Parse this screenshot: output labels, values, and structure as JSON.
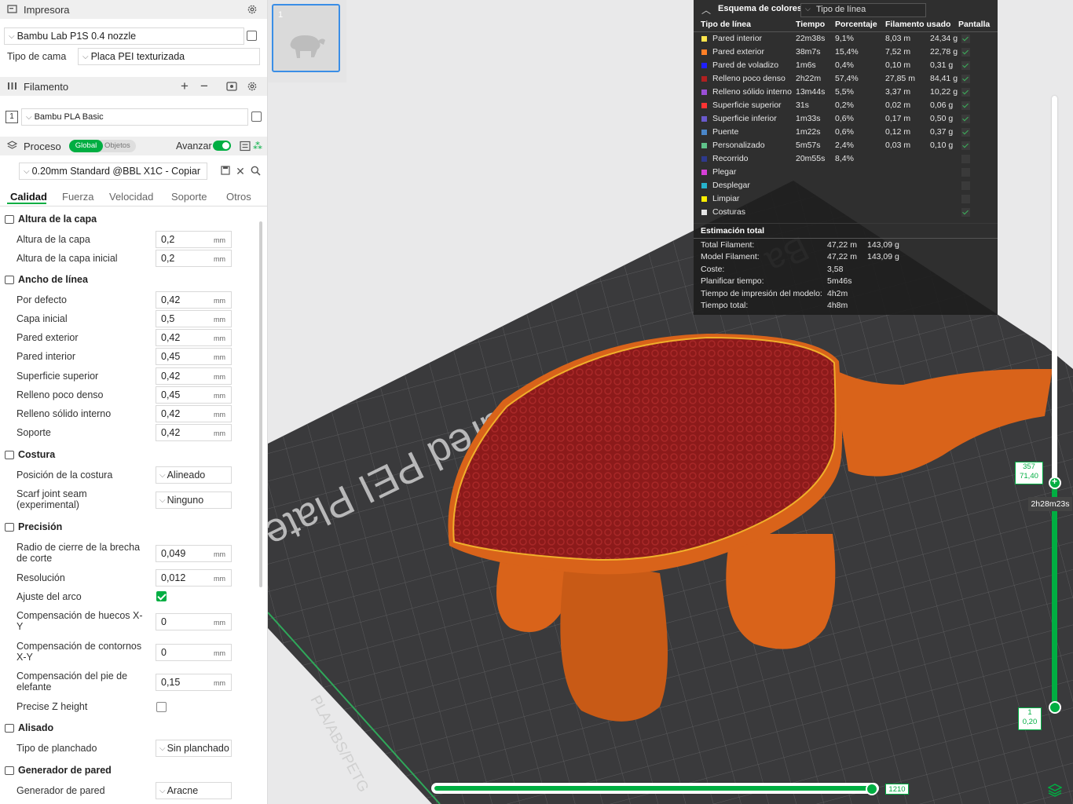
{
  "printer": {
    "section_label": "Impresora",
    "model": "Bambu Lab P1S 0.4 nozzle",
    "bed_label": "Tipo de cama",
    "bed_value": "Placa PEI texturizada"
  },
  "filament": {
    "section_label": "Filamento",
    "slot": "1",
    "name": "Bambu PLA Basic"
  },
  "process": {
    "section_label": "Proceso",
    "toggle_global": "Global",
    "toggle_objects": "Objetos",
    "advanced_label": "Avanzar",
    "preset": "0.20mm Standard @BBL X1C - Copiar"
  },
  "tabs": [
    "Calidad",
    "Fuerza",
    "Velocidad",
    "Soporte",
    "Otros"
  ],
  "groups": {
    "layer_height": "Altura de la capa",
    "line_width": "Ancho de línea",
    "seam": "Costura",
    "precision": "Precisión",
    "ironing": "Alisado",
    "wall_generator": "Generador de pared"
  },
  "settings": {
    "layer_height": {
      "label": "Altura de la capa",
      "value": "0,2",
      "unit": "mm"
    },
    "initial_layer_height": {
      "label": "Altura de la capa inicial",
      "value": "0,2",
      "unit": "mm"
    },
    "lw_default": {
      "label": "Por defecto",
      "value": "0,42",
      "unit": "mm"
    },
    "lw_initial": {
      "label": "Capa inicial",
      "value": "0,5",
      "unit": "mm"
    },
    "lw_outer": {
      "label": "Pared exterior",
      "value": "0,42",
      "unit": "mm"
    },
    "lw_inner": {
      "label": "Pared interior",
      "value": "0,45",
      "unit": "mm"
    },
    "lw_top": {
      "label": "Superficie superior",
      "value": "0,42",
      "unit": "mm"
    },
    "lw_sparse": {
      "label": "Relleno poco denso",
      "value": "0,45",
      "unit": "mm"
    },
    "lw_solid": {
      "label": "Relleno sólido interno",
      "value": "0,42",
      "unit": "mm"
    },
    "lw_support": {
      "label": "Soporte",
      "value": "0,42",
      "unit": "mm"
    },
    "seam_position": {
      "label": "Posición de la costura",
      "value": "Alineado"
    },
    "scarf_seam": {
      "label": "Scarf joint seam (experimental)",
      "value": "Ninguno"
    },
    "slice_gap": {
      "label": "Radio de cierre de la brecha de corte",
      "value": "0,049",
      "unit": "mm"
    },
    "resolution": {
      "label": "Resolución",
      "value": "0,012",
      "unit": "mm"
    },
    "arc_fitting": {
      "label": "Ajuste del arco",
      "checked": true
    },
    "xy_hole": {
      "label": "Compensación de huecos X-Y",
      "value": "0",
      "unit": "mm"
    },
    "xy_contour": {
      "label": "Compensación de contornos X-Y",
      "value": "0",
      "unit": "mm"
    },
    "elephant_foot": {
      "label": "Compensación del pie de elefante",
      "value": "0,15",
      "unit": "mm"
    },
    "precise_z": {
      "label": "Precise Z height",
      "checked": false
    },
    "ironing_type": {
      "label": "Tipo de planchado",
      "value": "Sin planchado"
    },
    "wall_gen": {
      "label": "Generador de pared",
      "value": "Aracne"
    }
  },
  "plate": {
    "thumb_number": "1",
    "bed_text": "Textured PEI Plate",
    "bed_text_partial": "Ba",
    "bed_badge": "PLA/ABS/PETG"
  },
  "legend": {
    "title": "Esquema de colores",
    "view_type": "Tipo de línea",
    "columns": [
      "Tipo de línea",
      "Tiempo",
      "Porcentaje",
      "Filamento usado",
      "Pantalla"
    ],
    "rows": [
      {
        "name": "Pared interior",
        "color": "#ffe54c",
        "time": "22m38s",
        "pct": "9,1%",
        "len": "8,03 m",
        "weight": "24,34 g",
        "shown": true
      },
      {
        "name": "Pared exterior",
        "color": "#ff7f26",
        "time": "38m7s",
        "pct": "15,4%",
        "len": "7,52 m",
        "weight": "22,78 g",
        "shown": true
      },
      {
        "name": "Pared de voladizo",
        "color": "#1f1fff",
        "time": "1m6s",
        "pct": "0,4%",
        "len": "0,10 m",
        "weight": "0,31 g",
        "shown": true
      },
      {
        "name": "Relleno poco denso",
        "color": "#b02020",
        "time": "2h22m",
        "pct": "57,4%",
        "len": "27,85 m",
        "weight": "84,41 g",
        "shown": true
      },
      {
        "name": "Relleno sólido interno",
        "color": "#9a4fd6",
        "time": "13m44s",
        "pct": "5,5%",
        "len": "3,37 m",
        "weight": "10,22 g",
        "shown": true
      },
      {
        "name": "Superficie superior",
        "color": "#ff3333",
        "time": "31s",
        "pct": "0,2%",
        "len": "0,02 m",
        "weight": "0,06 g",
        "shown": true
      },
      {
        "name": "Superficie inferior",
        "color": "#6a5acd",
        "time": "1m33s",
        "pct": "0,6%",
        "len": "0,17 m",
        "weight": "0,50 g",
        "shown": true
      },
      {
        "name": "Puente",
        "color": "#4a86c8",
        "time": "1m22s",
        "pct": "0,6%",
        "len": "0,12 m",
        "weight": "0,37 g",
        "shown": true
      },
      {
        "name": "Personalizado",
        "color": "#5fc38a",
        "time": "5m57s",
        "pct": "2,4%",
        "len": "0,03 m",
        "weight": "0,10 g",
        "shown": true
      },
      {
        "name": "Recorrido",
        "color": "#2e3a8c",
        "time": "20m55s",
        "pct": "8,4%",
        "len": "",
        "weight": "",
        "shown": false
      },
      {
        "name": "Plegar",
        "color": "#d63fd6",
        "time": "",
        "pct": "",
        "len": "",
        "weight": "",
        "shown": false
      },
      {
        "name": "Desplegar",
        "color": "#26b3cc",
        "time": "",
        "pct": "",
        "len": "",
        "weight": "",
        "shown": false
      },
      {
        "name": "Limpiar",
        "color": "#ffee00",
        "time": "",
        "pct": "",
        "len": "",
        "weight": "",
        "shown": false
      },
      {
        "name": "Costuras",
        "color": "#e6e6e6",
        "time": "",
        "pct": "",
        "len": "",
        "weight": "",
        "shown": true
      }
    ],
    "estimate_title": "Estimación total",
    "estimates": [
      {
        "label": "Total Filament:",
        "v1": "47,22 m",
        "v2": "143,09 g"
      },
      {
        "label": "Model Filament:",
        "v1": "47,22 m",
        "v2": "143,09 g"
      },
      {
        "label": "Coste:",
        "v1": "3,58",
        "v2": ""
      },
      {
        "label": "Planificar tiempo:",
        "v1": "5m46s",
        "v2": ""
      },
      {
        "label": "Tiempo de impresión del modelo:",
        "v1": "4h2m",
        "v2": ""
      },
      {
        "label": "Tiempo total:",
        "v1": "4h8m",
        "v2": ""
      }
    ]
  },
  "layer_slider": {
    "top_layer": "357",
    "top_height": "71,40",
    "time_tip": "2h28m23s",
    "bottom_layer": "1",
    "bottom_height": "0,20"
  },
  "move_slider": {
    "value": "1210"
  },
  "colors": {
    "accent": "#00ae42",
    "model": "#d9631a",
    "infill": "#8c1a1a",
    "bed": "#3a3a3c"
  }
}
